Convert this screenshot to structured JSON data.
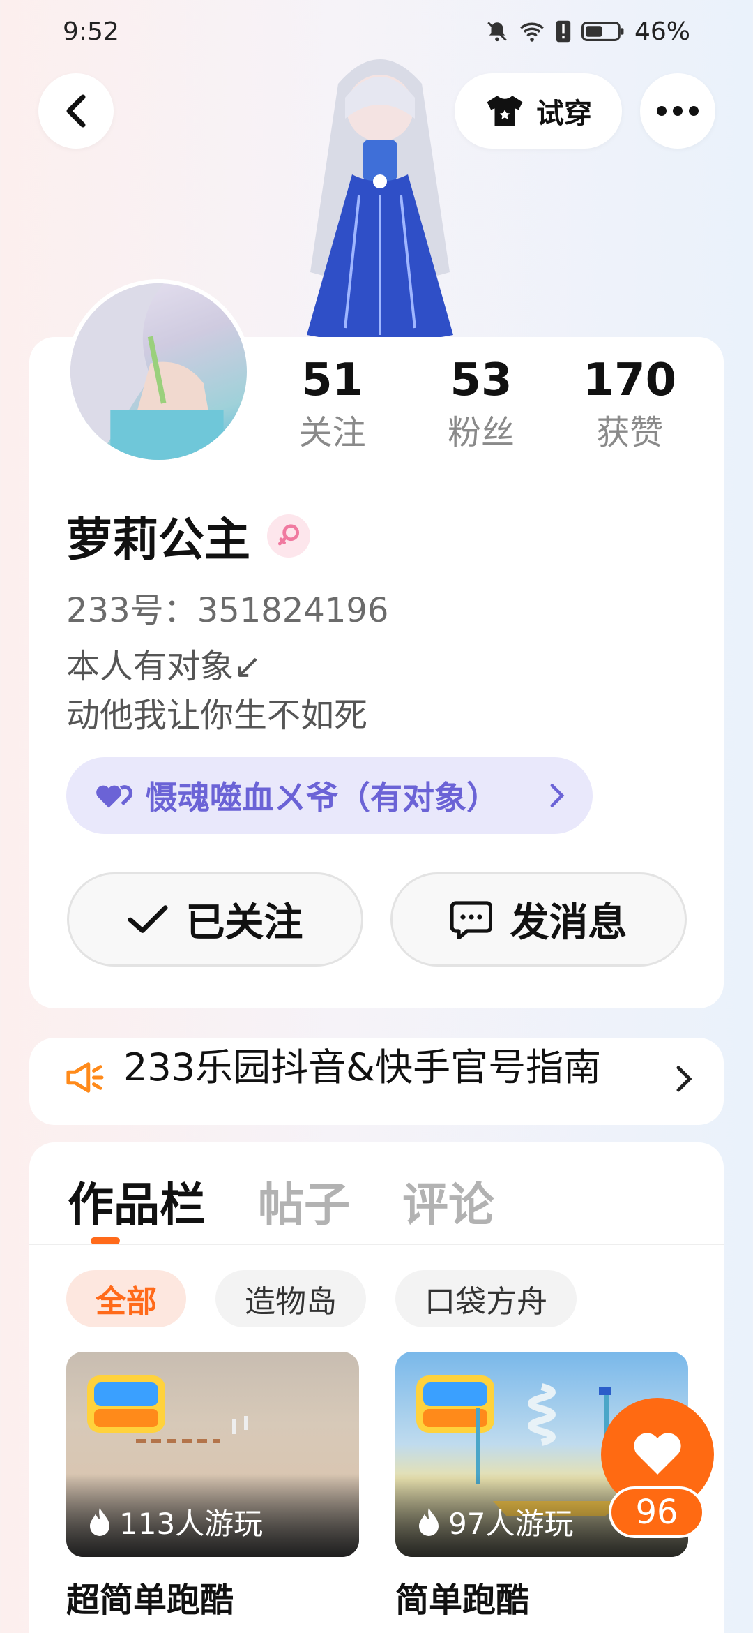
{
  "status_bar": {
    "time": "9:52",
    "battery": "46%"
  },
  "header": {
    "tryon_label": "试穿"
  },
  "stats": [
    {
      "value": "51",
      "label": "关注"
    },
    {
      "value": "53",
      "label": "粉丝"
    },
    {
      "value": "170",
      "label": "获赞"
    }
  ],
  "profile": {
    "name": "萝莉公主",
    "uid": "233号：351824196",
    "bio": "本人有对象↙\n动他我让你生不如死",
    "relation": "慑魂噬血ㄨ爷（有对象）"
  },
  "actions": {
    "follow_label": "已关注",
    "message_label": "发消息"
  },
  "notice": {
    "text": "233乐园抖音&快手官号指南"
  },
  "tabs": [
    "作品栏",
    "帖子",
    "评论"
  ],
  "filters": [
    "全部",
    "造物岛",
    "口袋方舟"
  ],
  "works": [
    {
      "plays": "113人游玩",
      "title": "超简单跑酷"
    },
    {
      "plays": "97人游玩",
      "title": "简单跑酷"
    }
  ],
  "like": {
    "count": "96"
  },
  "colors": {
    "accent": "#ff6a12",
    "relation": "#6b63d6"
  }
}
